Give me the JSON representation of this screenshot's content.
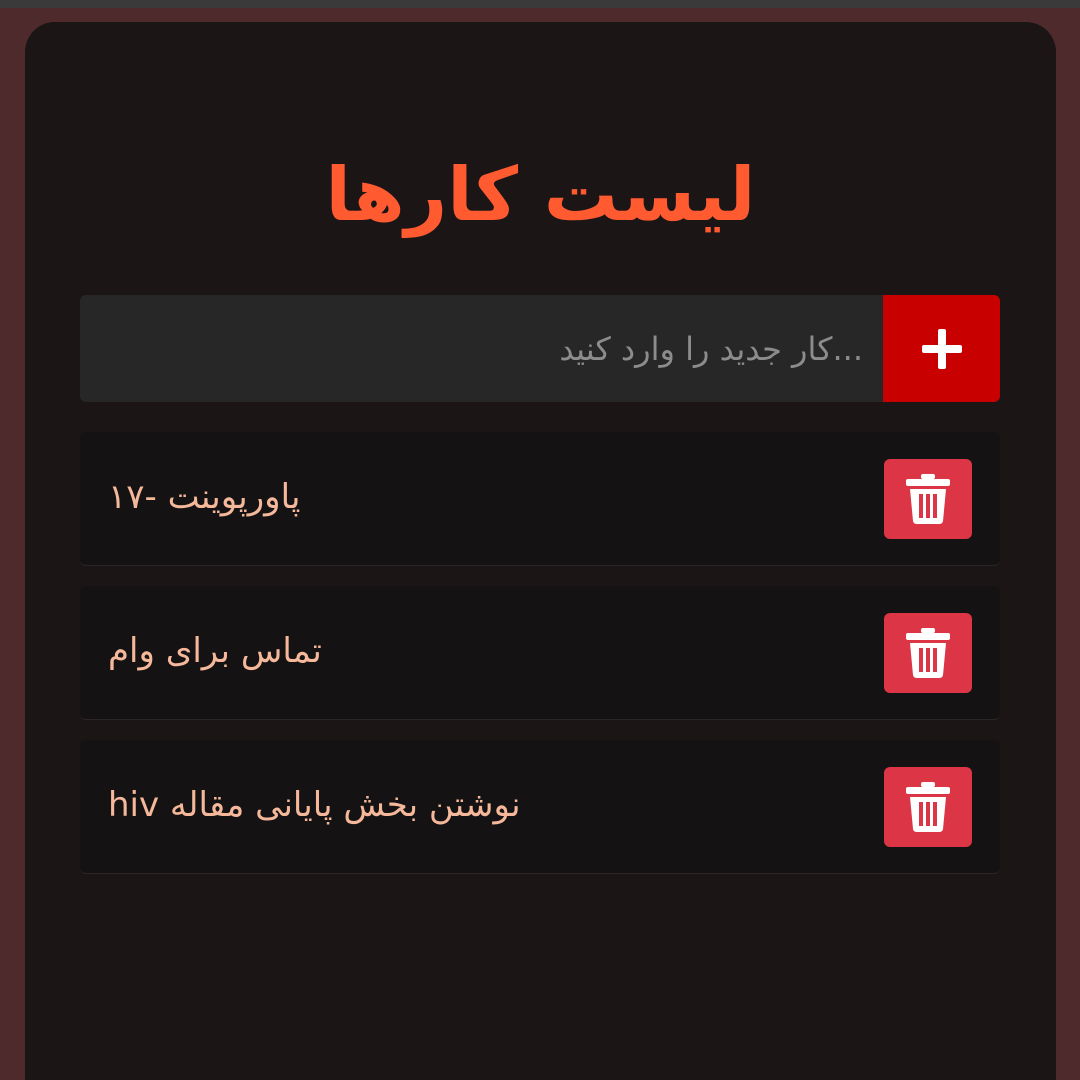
{
  "app": {
    "title": "لیست  کارها"
  },
  "input": {
    "placeholder": "...کار جدید را وارد کنید",
    "value": ""
  },
  "add_button": {
    "icon": "plus-icon"
  },
  "tasks": [
    {
      "text": "پاورپوینت -۱۷",
      "delete_icon": "trash-icon"
    },
    {
      "text": "تماس برای وام",
      "delete_icon": "trash-icon"
    },
    {
      "text": "نوشتن بخش پایانی مقاله hiv",
      "delete_icon": "trash-icon"
    }
  ],
  "colors": {
    "background": "#4f2a2d",
    "card": "#1b1516",
    "accent_title": "#ff5a30",
    "add_button": "#c80000",
    "delete_button": "#dc3545",
    "task_text": "#f5b89a"
  }
}
